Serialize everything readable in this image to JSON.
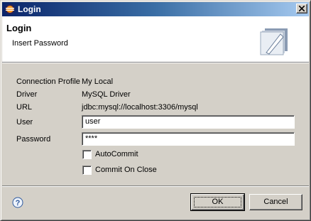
{
  "window": {
    "title": "Login"
  },
  "header": {
    "title": "Login",
    "message": "Insert Password"
  },
  "form": {
    "connection_profile": {
      "label": "Connection Profile",
      "value": "My Local"
    },
    "driver": {
      "label": "Driver",
      "value": "MySQL Driver"
    },
    "url": {
      "label": "URL",
      "value": "jdbc:mysql://localhost:3306/mysql"
    },
    "user": {
      "label": "User",
      "value": "user"
    },
    "password": {
      "label": "Password",
      "value": "****"
    },
    "autocommit": {
      "label": "AutoCommit",
      "checked": false
    },
    "commit_on_close": {
      "label": "Commit On Close",
      "checked": false
    }
  },
  "buttons": {
    "ok": "OK",
    "cancel": "Cancel"
  },
  "icons": {
    "app": "eclipse-icon",
    "close": "close-icon",
    "banner": "wizard-banner-icon",
    "help": "help-icon"
  }
}
